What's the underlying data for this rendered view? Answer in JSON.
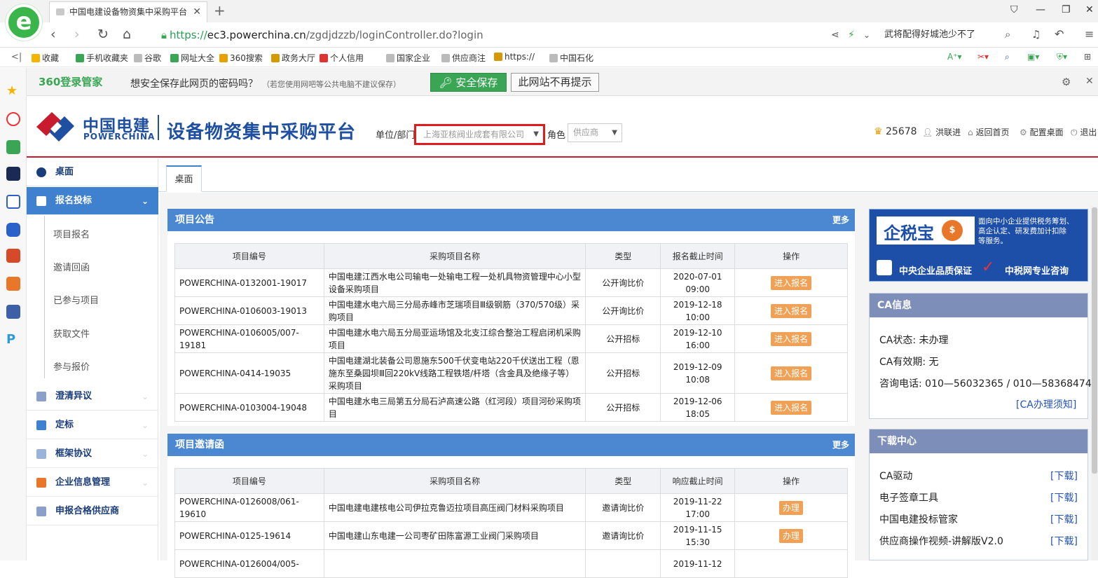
{
  "browser": {
    "tab_title": "中国电建设备物资集中采购平台",
    "url_scheme": "https://",
    "url_domain": "ec3.powerchina.cn",
    "url_path": "/zgdjdzzb/loginController.do?login",
    "search_text": "武将配得好城池少不了",
    "logo_letter": "e"
  },
  "bookmarks": [
    {
      "label": "收藏",
      "color": "#f5b400"
    },
    {
      "label": "手机收藏夹",
      "color": "#3aa655"
    },
    {
      "label": "谷歌",
      "color": "#bbb"
    },
    {
      "label": "网址大全",
      "color": "#3aa655"
    },
    {
      "label": "360搜索",
      "color": "#e8a000"
    },
    {
      "label": "政务大厅",
      "color": "#d49a00"
    },
    {
      "label": "个人信用",
      "color": "#d33"
    },
    {
      "label": "国家企业",
      "color": "#bbb"
    },
    {
      "label": "供应商注",
      "color": "#bbb"
    },
    {
      "label": "https://",
      "color": "#d49a00"
    },
    {
      "label": "中国石化",
      "color": "#bbb"
    }
  ],
  "password_bar": {
    "logo": "360登录管家",
    "message": "想安全保存此网页的密码吗？",
    "sub": "（若您使用网吧等公共电脑不建议保存）",
    "save_label": "安全保存",
    "never_label": "此网站不再提示"
  },
  "header": {
    "logo_cn": "中国电建",
    "logo_en": "POWERCHINA",
    "platform_title": "设备物资集中采购平台",
    "unit_label": "单位/部门",
    "unit_value": "上海亚核阀业成套有限公司",
    "role_label": "角色",
    "role_value": "供应商",
    "points": "25678",
    "user": "洪联进",
    "home": "返回首页",
    "config": "配置桌面",
    "logout": "退出"
  },
  "nav": {
    "desk": "桌面",
    "bid": "报名投标",
    "bid_items": [
      "项目报名",
      "邀请回函",
      "已参与项目",
      "获取文件",
      "参与报价"
    ],
    "clarify": "澄清异议",
    "award": "定标",
    "framework": "框架协议",
    "enterprise": "企业信息管理",
    "qualified": "申报合格供应商"
  },
  "content_tab": "桌面",
  "announce": {
    "title": "项目公告",
    "more": "更多",
    "headers": [
      "项目编号",
      "采购项目名称",
      "类型",
      "报名截止时间",
      "操作"
    ],
    "rows": [
      {
        "code": "POWERCHINA-0132001-19017",
        "name": "中国电建江西水电公司输电一处输电工程一处机具物资管理中心小型设备采购项目",
        "type": "公开询比价",
        "deadline_date": "2020-07-01",
        "deadline_time": "09:00",
        "op": "进入报名"
      },
      {
        "code": "POWERCHINA-0106003-19013",
        "name": "中国电建水电六局三分局赤峰市芝瑞项目Ⅲ级钢筋（370/570级）采购项目",
        "type": "公开询比价",
        "deadline_date": "2019-12-18",
        "deadline_time": "10:00",
        "op": "进入报名"
      },
      {
        "code": "POWERCHINA-0106005/007-19181",
        "name": "中国电建水电六局五分局亚运场馆及北支江综合整治工程启闭机采购项目",
        "type": "公开招标",
        "deadline_date": "2019-12-10",
        "deadline_time": "16:00",
        "op": "进入报名"
      },
      {
        "code": "POWERCHINA-0414-19035",
        "name": "中国电建湖北装备公司恩施东500千伏变电站220千伏送出工程（恩施东至桑园坝Ⅲ回220kV线路工程铁塔/杆塔（含金具及绝缘子等）采购项目",
        "type": "公开招标",
        "deadline_date": "2019-12-09",
        "deadline_time": "10:08",
        "op": "进入报名"
      },
      {
        "code": "POWERCHINA-0103004-19048",
        "name": "中国电建水电三局第五分局石泸高速公路（红河段）项目河砂采购项目",
        "type": "公开招标",
        "deadline_date": "2019-12-06",
        "deadline_time": "18:05",
        "op": "进入报名"
      }
    ]
  },
  "invite": {
    "title": "项目邀请函",
    "more": "更多",
    "headers": [
      "项目编号",
      "采购项目名称",
      "类型",
      "响应截止时间",
      "操作"
    ],
    "rows": [
      {
        "code": "POWERCHINA-0126008/061-19610",
        "name": "中国电建电建核电公司伊拉克鲁迈拉项目高压阀门材料采购项目",
        "type": "邀请询比价",
        "deadline_date": "2019-11-22",
        "deadline_time": "17:00",
        "op": "办理"
      },
      {
        "code": "POWERCHINA-0125-19614",
        "name": "中国电建山东电建一公司枣矿田陈富源工业阀门采购项目",
        "type": "邀请询比价",
        "deadline_date": "2019-11-15",
        "deadline_time": "15:30",
        "op": "办理"
      },
      {
        "code": "POWERCHINA-0126004/005-",
        "name": "",
        "type": "",
        "deadline_date": "2019-11-12",
        "deadline_time": "",
        "op": ""
      }
    ]
  },
  "ad": {
    "brand": "企税宝",
    "line1": "面向中小企业提供税务筹划、",
    "line2": "高企认定、研发费加计扣除",
    "line3": "等服务。",
    "slogan_left": "中央企业品质保证",
    "slogan_right": "中税网专业咨询"
  },
  "ca": {
    "title": "CA信息",
    "status": "CA状态: 未办理",
    "validity": "CA有效期: 无",
    "phone": "咨询电话: 010—56032365 / 010—58368474",
    "link": "[CA办理须知]"
  },
  "downloads": {
    "title": "下载中心",
    "link_label": "[下载]",
    "items": [
      "CA驱动",
      "电子签章工具",
      "中国电建投标管家",
      "供应商操作视频-讲解版V2.0"
    ]
  },
  "colors": {
    "brand_blue": "#1f4fa0",
    "brand_red": "#c81c2e",
    "panel_blue": "#4b88d1",
    "nav_active": "#3f80cf",
    "op_orange": "#f0a155",
    "green": "#3aa655"
  }
}
